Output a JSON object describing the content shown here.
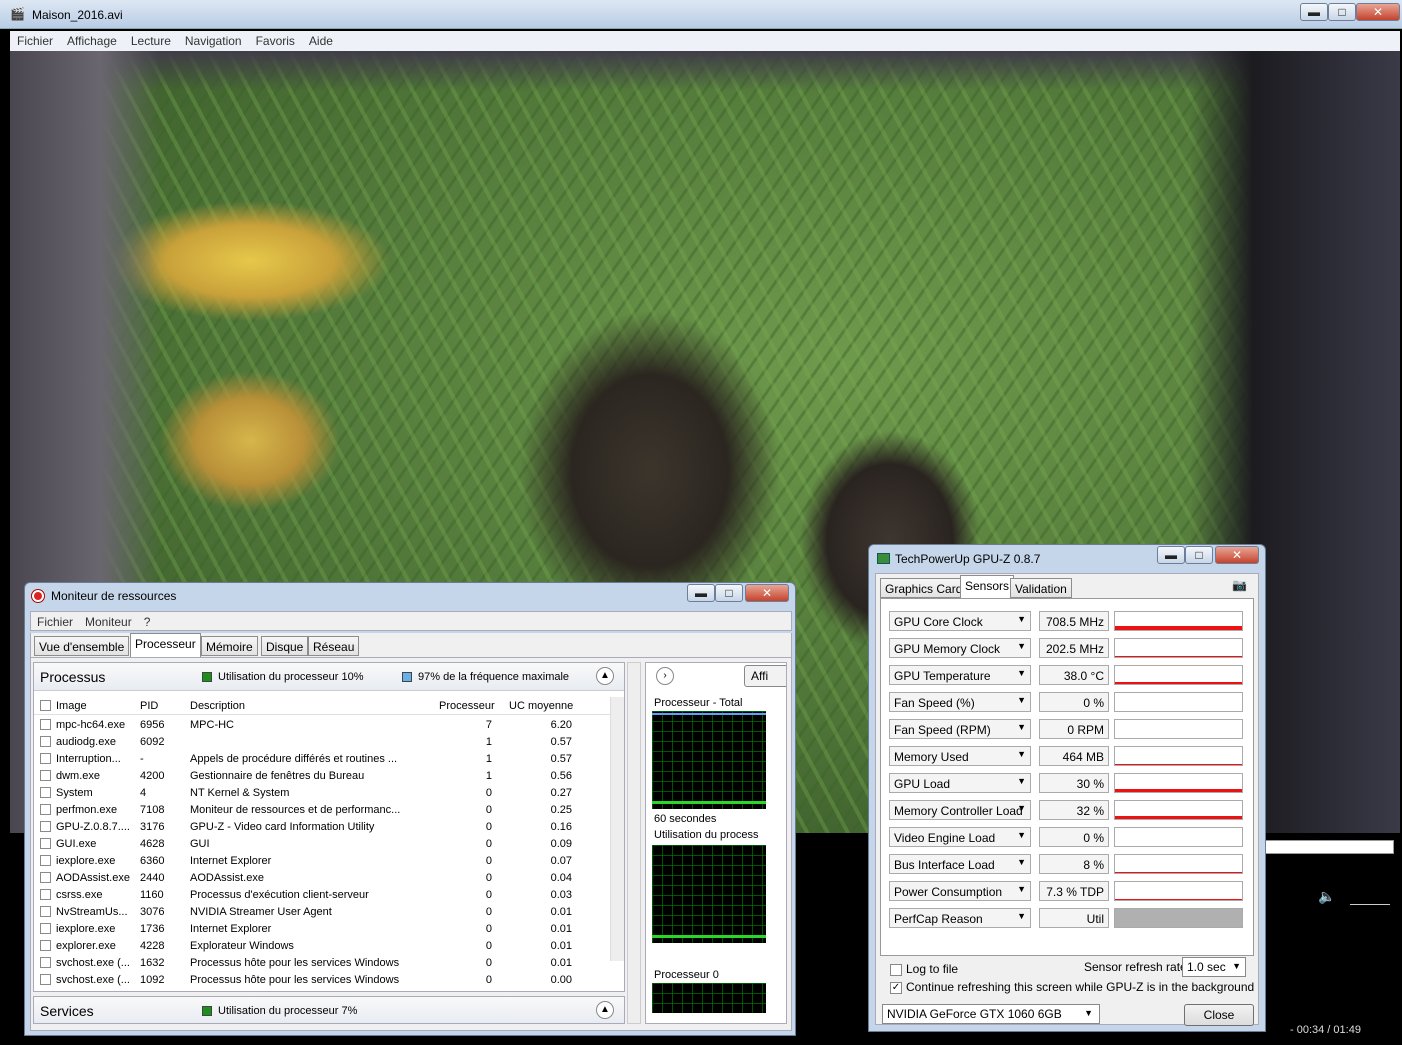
{
  "player": {
    "title": "Maison_2016.avi",
    "menu": [
      "Fichier",
      "Affichage",
      "Lecture",
      "Navigation",
      "Favoris",
      "Aide"
    ],
    "time": "- 00:34 / 01:49",
    "win_min": "▬",
    "win_max": "□",
    "win_close": "✕"
  },
  "resmon": {
    "title": "Moniteur de ressources",
    "menu": [
      "Fichier",
      "Moniteur",
      "?"
    ],
    "tabs": [
      "Vue d'ensemble",
      "Processeur",
      "Mémoire",
      "Disque",
      "Réseau"
    ],
    "active_tab": 1,
    "processes": {
      "title": "Processus",
      "legend1": "Utilisation du processeur 10%",
      "legend2": "97% de la fréquence maximale",
      "columns": [
        "Image",
        "PID",
        "Description",
        "Processeur",
        "UC moyenne"
      ],
      "rows": [
        [
          "mpc-hc64.exe",
          "6956",
          "MPC-HC",
          "7",
          "6.20"
        ],
        [
          "audiodg.exe",
          "6092",
          "",
          "1",
          "0.57"
        ],
        [
          "Interruption...",
          "-",
          "Appels de procédure différés et routines ...",
          "1",
          "0.57"
        ],
        [
          "dwm.exe",
          "4200",
          "Gestionnaire de fenêtres du Bureau",
          "1",
          "0.56"
        ],
        [
          "System",
          "4",
          "NT Kernel & System",
          "0",
          "0.27"
        ],
        [
          "perfmon.exe",
          "7108",
          "Moniteur de ressources et de performanc...",
          "0",
          "0.25"
        ],
        [
          "GPU-Z.0.8.7....",
          "3176",
          "GPU-Z - Video card Information Utility",
          "0",
          "0.16"
        ],
        [
          "GUI.exe",
          "4628",
          "GUI",
          "0",
          "0.09"
        ],
        [
          "iexplore.exe",
          "6360",
          "Internet Explorer",
          "0",
          "0.07"
        ],
        [
          "AODAssist.exe",
          "2440",
          "AODAssist.exe",
          "0",
          "0.04"
        ],
        [
          "csrss.exe",
          "1160",
          "Processus d'exécution client-serveur",
          "0",
          "0.03"
        ],
        [
          "NvStreamUs...",
          "3076",
          "NVIDIA Streamer User Agent",
          "0",
          "0.01"
        ],
        [
          "iexplore.exe",
          "1736",
          "Internet Explorer",
          "0",
          "0.01"
        ],
        [
          "explorer.exe",
          "4228",
          "Explorateur Windows",
          "0",
          "0.01"
        ],
        [
          "svchost.exe (...",
          "1632",
          "Processus hôte pour les services Windows",
          "0",
          "0.01"
        ],
        [
          "svchost.exe (...",
          "1092",
          "Processus hôte pour les services Windows",
          "0",
          "0.00"
        ]
      ]
    },
    "services": {
      "title": "Services",
      "legend": "Utilisation du processeur 7%"
    },
    "graphs": {
      "view_button": "Affi",
      "total_label": "Processeur - Total",
      "seconds": "60 secondes",
      "usage_label": "Utilisation du process",
      "cpu0_label": "Processeur 0"
    }
  },
  "gpuz": {
    "title": "TechPowerUp GPU-Z 0.8.7",
    "tabs": [
      "Graphics Card",
      "Sensors",
      "Validation"
    ],
    "active_tab": 1,
    "sensors": [
      {
        "name": "GPU Core Clock",
        "value": "708.5 MHz",
        "level": 0.35
      },
      {
        "name": "GPU Memory Clock",
        "value": "202.5 MHz",
        "level": 0.05
      },
      {
        "name": "GPU Temperature",
        "value": "38.0 °C",
        "level": 0.2
      },
      {
        "name": "Fan Speed (%)",
        "value": "0 %",
        "level": 0
      },
      {
        "name": "Fan Speed (RPM)",
        "value": "0 RPM",
        "level": 0
      },
      {
        "name": "Memory Used",
        "value": "464 MB",
        "level": 0.05
      },
      {
        "name": "GPU Load",
        "value": "30 %",
        "level": 0.3
      },
      {
        "name": "Memory Controller Load",
        "value": "32 %",
        "level": 0.32
      },
      {
        "name": "Video Engine Load",
        "value": "0 %",
        "level": 0
      },
      {
        "name": "Bus Interface Load",
        "value": "8 %",
        "level": 0.08
      },
      {
        "name": "Power Consumption",
        "value": "7.3 % TDP",
        "level": 0.07
      },
      {
        "name": "PerfCap Reason",
        "value": "Util",
        "level": 1
      }
    ],
    "log_to_file": "Log to file",
    "refresh_label": "Sensor refresh rate:",
    "refresh_value": "1.0 sec",
    "continue_label": "Continue refreshing this screen while GPU-Z is in the background",
    "card": "NVIDIA GeForce GTX 1060 6GB",
    "close": "Close"
  }
}
